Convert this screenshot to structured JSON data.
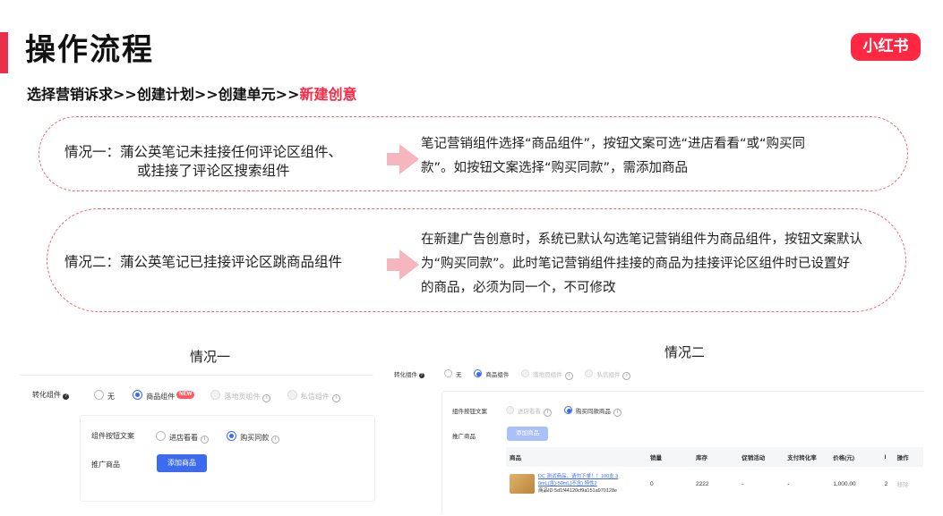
{
  "header": {
    "title": "操作流程",
    "logo_text": "小红书"
  },
  "flow": {
    "steps": "选择营销诉求>>创建计划>>创建单元>>",
    "highlight": "新建创意"
  },
  "cases": [
    {
      "left_line1": "情况一：蒲公英笔记未挂接任何评论区组件、",
      "left_line2": "或挂接了评论区搜索组件",
      "right_line1": "笔记营销组件选择“商品组件”，按钮文案可选“进店看看“或“购买同",
      "right_line2": "款”。如按钮文案选择“购买同款”，需添加商品"
    },
    {
      "left_line1": "情况二：蒲公英笔记已挂接评论区跳商品组件",
      "right_line1": "在新建广告创意时，系统已默认勾选笔记营销组件为商品组件，按钮文案默认",
      "right_line2": "为“购买同款”。此时笔记营销组件挂接的商品为挂接评论区组件时已设置好",
      "right_line3": "的商品，必须为同一个，不可修改"
    }
  ],
  "shot1": {
    "caption": "情况一",
    "component_label": "转化组件",
    "options": [
      "无",
      "商品组件",
      "落地页组件",
      "私信组件"
    ],
    "new_badge": "NEW",
    "button_text_label": "组件按钮文案",
    "button_options": [
      "进店看看",
      "购买同款"
    ],
    "promo_label": "推广商品",
    "add_button": "添加商品"
  },
  "shot2": {
    "caption": "情况二",
    "component_label": "转化组件",
    "options": [
      "无",
      "商品组件",
      "落地页组件",
      "私信组件"
    ],
    "button_text_label": "组件按钮文案",
    "button_options": [
      "进店看看",
      "购买同款商品"
    ],
    "promo_label": "推广商品",
    "add_button": "添加商品",
    "table": {
      "headers": [
        "商品",
        "销量",
        "库存",
        "促销活动",
        "支付转化率",
        "价格(元)",
        "I",
        "操作"
      ],
      "row": {
        "name_line1": "DC 测试商品，请勿下单！！100支 3",
        "name_line2": "0mL(含)-50mL(不含) 特性2",
        "id_line": "商品ID:5d1f44120cf9a151a970128e",
        "sales": "0",
        "stock": "2222",
        "promo": "-",
        "conversion": "-",
        "price": "1,000.00",
        "extra": "2",
        "action": "移除"
      }
    }
  }
}
